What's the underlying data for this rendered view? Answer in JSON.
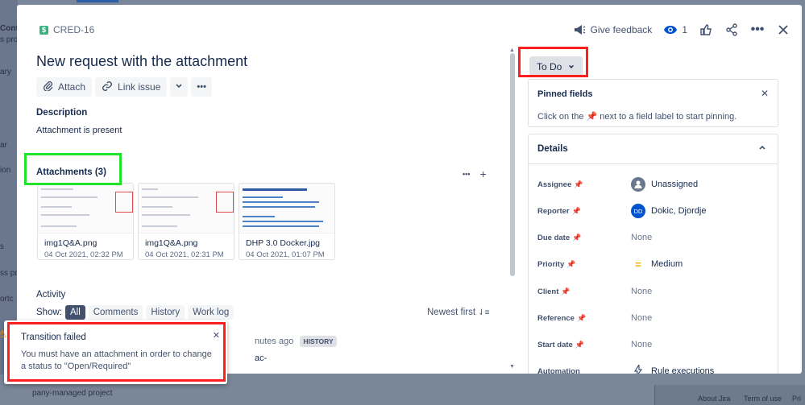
{
  "background": {
    "left_fragments": [
      "Cont",
      "s proj",
      "ary",
      "ar",
      "ion",
      "s",
      "ss pr",
      "ortc"
    ],
    "project_text": "pany-managed project",
    "footer_links": [
      "About Jira",
      "Term of use",
      "Pri"
    ]
  },
  "issue": {
    "key": "CRED-16",
    "type_icon": "story-icon",
    "title": "New request with the attachment"
  },
  "top_actions": {
    "give_feedback": "Give feedback",
    "watch_count": "1"
  },
  "toolbar": {
    "attach_label": "Attach",
    "link_issue_label": "Link issue"
  },
  "description": {
    "label": "Description",
    "text": "Attachment is present"
  },
  "attachments": {
    "label": "Attachments (3)",
    "items": [
      {
        "name": "img1Q&A.png",
        "date": "04 Oct 2021, 02:32 PM"
      },
      {
        "name": "img1Q&A.png",
        "date": "04 Oct 2021, 02:31 PM"
      },
      {
        "name": "DHP 3.0 Docker.jpg",
        "date": "04 Oct 2021, 01:07 PM"
      }
    ]
  },
  "activity": {
    "label": "Activity",
    "show_label": "Show:",
    "filters": [
      "All",
      "Comments",
      "History",
      "Work log"
    ],
    "sort_label": "Newest first",
    "history_time": "nutes ago",
    "history_badge": "HISTORY",
    "fragment": "ac-"
  },
  "status": {
    "label": "To Do"
  },
  "pinned": {
    "title": "Pinned fields",
    "hint": "Click on the 📌 next to a field label to start pinning."
  },
  "details": {
    "title": "Details",
    "fields": [
      {
        "label": "Assignee",
        "value": "Unassigned"
      },
      {
        "label": "Reporter",
        "value": "Dokic, Djordje",
        "initials": "DD"
      },
      {
        "label": "Due date",
        "value": "None"
      },
      {
        "label": "Priority",
        "value": "Medium"
      },
      {
        "label": "Client",
        "value": "None"
      },
      {
        "label": "Reference",
        "value": "None"
      },
      {
        "label": "Start date",
        "value": "None"
      },
      {
        "label": "Automation",
        "value": "Rule executions"
      }
    ]
  },
  "toast": {
    "title": "Transition failed",
    "message": "You must have an attachment in order to change a status to \"Open/Required\""
  },
  "colors": {
    "highlight_green": "#21e32a",
    "highlight_red": "#ff1f1f",
    "primary": "#0052CC",
    "priority_medium": "#FFAB00"
  }
}
